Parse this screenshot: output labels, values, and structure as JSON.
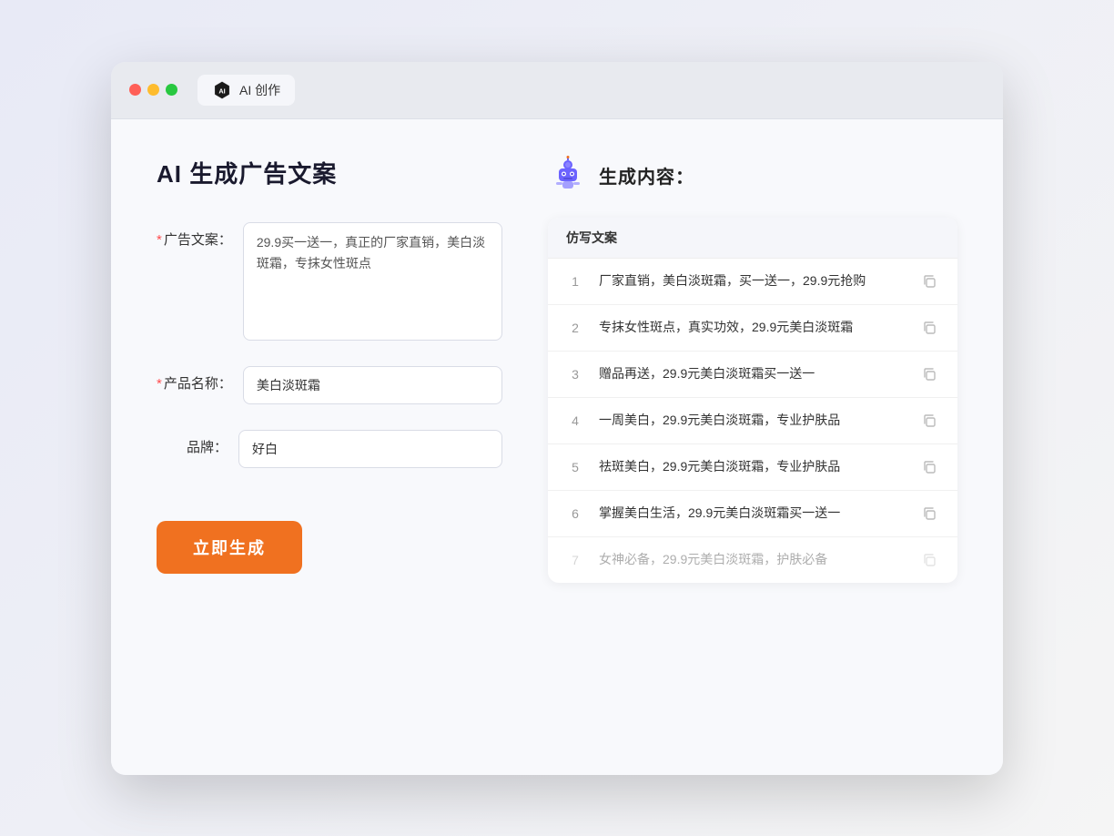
{
  "browser": {
    "tab_label": "AI 创作"
  },
  "page": {
    "title": "AI 生成广告文案",
    "result_title": "生成内容："
  },
  "form": {
    "ad_copy_label": "广告文案：",
    "ad_copy_required": "*",
    "ad_copy_value": "29.9买一送一，真正的厂家直销，美白淡斑霜，专抹女性斑点",
    "product_name_label": "产品名称：",
    "product_name_required": "*",
    "product_name_value": "美白淡斑霜",
    "brand_label": "品牌：",
    "brand_value": "好白",
    "generate_button_label": "立即生成"
  },
  "results": {
    "column_header": "仿写文案",
    "items": [
      {
        "id": 1,
        "text": "厂家直销，美白淡斑霜，买一送一，29.9元抢购"
      },
      {
        "id": 2,
        "text": "专抹女性斑点，真实功效，29.9元美白淡斑霜"
      },
      {
        "id": 3,
        "text": "赠品再送，29.9元美白淡斑霜买一送一"
      },
      {
        "id": 4,
        "text": "一周美白，29.9元美白淡斑霜，专业护肤品"
      },
      {
        "id": 5,
        "text": "祛斑美白，29.9元美白淡斑霜，专业护肤品"
      },
      {
        "id": 6,
        "text": "掌握美白生活，29.9元美白淡斑霜买一送一"
      },
      {
        "id": 7,
        "text": "女神必备，29.9元美白淡斑霜，护肤必备",
        "faded": true
      }
    ]
  }
}
